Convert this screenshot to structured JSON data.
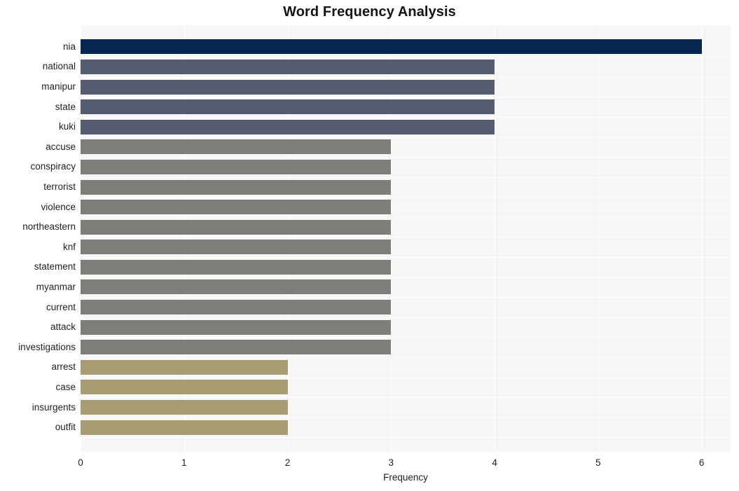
{
  "chart_data": {
    "type": "bar",
    "orientation": "horizontal",
    "title": "Word Frequency Analysis",
    "xlabel": "Frequency",
    "ylabel": "",
    "categories": [
      "nia",
      "national",
      "manipur",
      "state",
      "kuki",
      "accuse",
      "conspiracy",
      "terrorist",
      "violence",
      "northeastern",
      "knf",
      "statement",
      "myanmar",
      "current",
      "attack",
      "investigations",
      "arrest",
      "case",
      "insurgents",
      "outfit"
    ],
    "values": [
      6,
      4,
      4,
      4,
      4,
      3,
      3,
      3,
      3,
      3,
      3,
      3,
      3,
      3,
      3,
      3,
      2,
      2,
      2,
      2
    ],
    "bar_colors": [
      "#042650",
      "#565c70",
      "#565c70",
      "#565c70",
      "#565c70",
      "#7e7d79",
      "#7e7d79",
      "#7e7d79",
      "#7e7d79",
      "#7e7d79",
      "#7e7d79",
      "#7e7d79",
      "#7e7d79",
      "#7e7d79",
      "#7e7d79",
      "#7e7d79",
      "#a89d72",
      "#a89d72",
      "#a89d72",
      "#a89d72"
    ],
    "xlim": [
      0,
      6.28
    ],
    "xticks": [
      0,
      1,
      2,
      3,
      4,
      5,
      6
    ],
    "xtick_labels": [
      "0",
      "1",
      "2",
      "3",
      "4",
      "5",
      "6"
    ],
    "grid": true,
    "grid_color": "#ffffff",
    "plot_background": "#f6f6f7",
    "figure_background": "#ffffff",
    "legend": null
  }
}
